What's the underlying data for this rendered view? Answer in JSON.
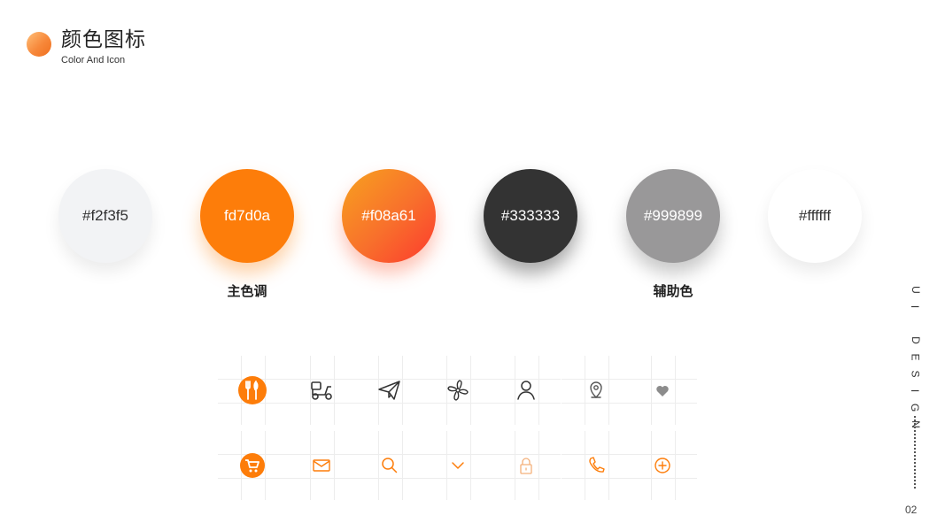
{
  "header": {
    "title": "颜色图标",
    "subtitle": "Color And Icon"
  },
  "swatches": [
    {
      "label": "#f2f3f5",
      "color": "#f2f3f5"
    },
    {
      "label": "fd7d0a",
      "color": "#fd7d0a"
    },
    {
      "label": "#f08a61",
      "color": "#f08a61"
    },
    {
      "label": "#333333",
      "color": "#333333"
    },
    {
      "label": "#999899",
      "color": "#999899"
    },
    {
      "label": "#ffffff",
      "color": "#ffffff"
    }
  ],
  "groups": {
    "primary": "主色调",
    "secondary": "辅助色"
  },
  "icons": {
    "row1": [
      "utensils",
      "scooter",
      "paper-plane",
      "fan",
      "user",
      "location-pin",
      "heart"
    ],
    "row2": [
      "cart",
      "mail",
      "search",
      "chevron-down",
      "lock",
      "phone",
      "plus-circle"
    ]
  },
  "colors": {
    "accent": "#fd7d0a",
    "gradient_start": "#f7a21f",
    "gradient_end": "#fd3a2e",
    "dark": "#333333",
    "grey": "#999899"
  },
  "side": {
    "label": "UI DESIGN",
    "page_number": "02"
  }
}
